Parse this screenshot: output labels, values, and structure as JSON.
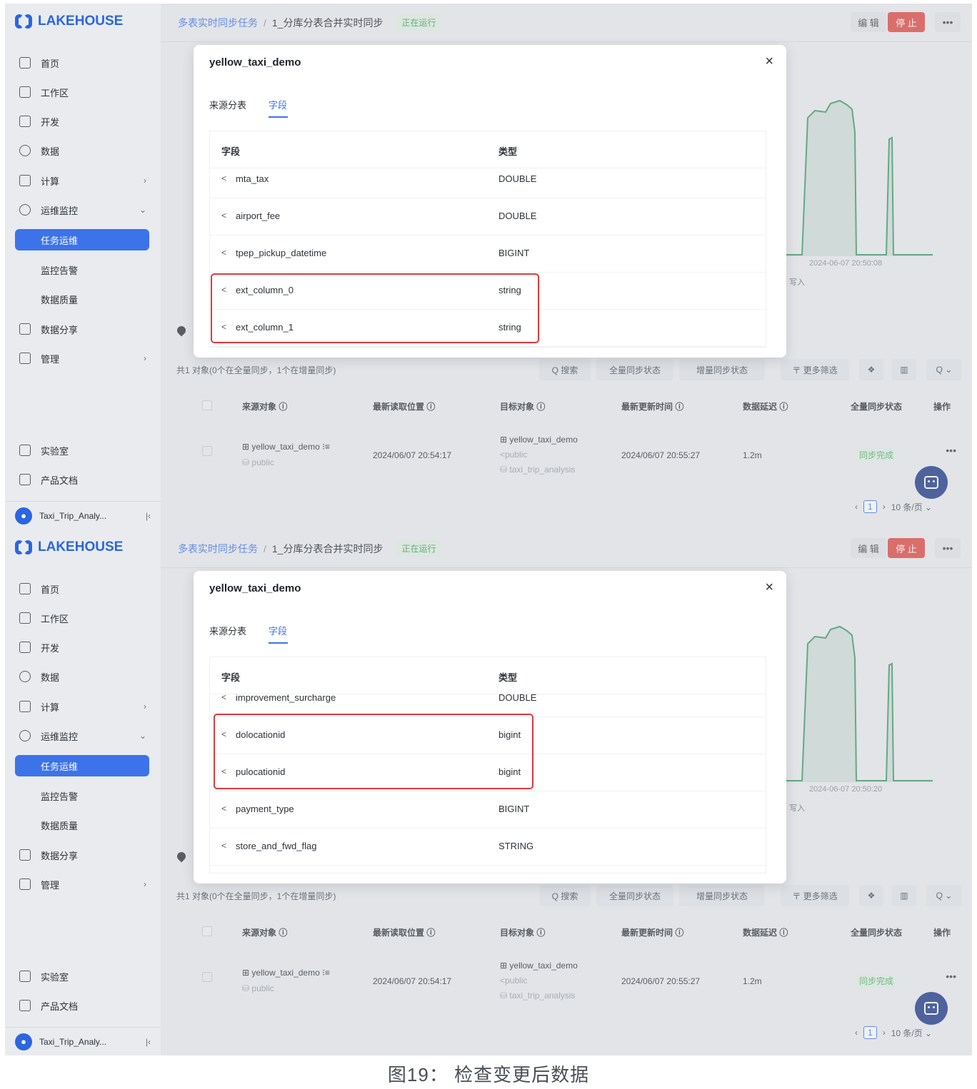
{
  "sidebar": {
    "logo": "LAKEHOUSE",
    "items": [
      "首页",
      "工作区",
      "开发",
      "数据",
      "计算",
      "运维监控"
    ],
    "sub_items": [
      "任务运维",
      "监控告警",
      "数据质量"
    ],
    "items_after": [
      "数据分享",
      "管理"
    ],
    "bottom_items": [
      "实验室",
      "产品文档"
    ],
    "workspace_avatar": "●",
    "workspace": "Taxi_Trip_Analy..."
  },
  "header": {
    "breadcrumb_root": "多表实时同步任务",
    "breadcrumb_sep": "/",
    "breadcrumb_current": "1_分库分表合并实时同步",
    "status": "正在运行",
    "edit": "编 辑",
    "stop": "停 止",
    "more": "•••"
  },
  "charts": [
    {
      "date_label": "2024-06-07 20:50:08",
      "legend": "写入"
    },
    {
      "date_label": "2024-06-07 20:50:20",
      "legend": "写入"
    }
  ],
  "list": {
    "summary": "共1 对象(0个在全量同步，1个在增量同步)",
    "toolbar": [
      "Q 搜索",
      "全量同步状态",
      "增量同步状态",
      "〒 更多筛选",
      "❖",
      "▥",
      "Q ⌄"
    ],
    "columns": [
      "来源对象 ⓘ",
      "最新读取位置 ⓘ",
      "目标对象 ⓘ",
      "最新更新时间 ⓘ",
      "数据延迟 ⓘ",
      "全量同步状态",
      "操作"
    ],
    "row": {
      "source": "⊞ yellow_taxi_demo ⁝≡",
      "source_schema": "⛁ public",
      "read_pos": "2024/06/07 20:54:17",
      "target": "⊞ yellow_taxi_demo",
      "target_schema": "<public",
      "target_db": "⛁ taxi_trip_analysis",
      "update_time": "2024/06/07 20:55:27",
      "latency": "1.2m",
      "full_status": "同步完成",
      "more": "•••"
    },
    "pager": {
      "prev": "‹",
      "page": "1",
      "next": "›",
      "size": "10 条/页 ⌄"
    }
  },
  "modals": [
    {
      "title": "yellow_taxi_demo",
      "close": "×",
      "tab_source": "来源分表",
      "tab_fields": "字段",
      "col_field": "字段",
      "col_type": "类型",
      "rows": [
        {
          "name": "mta_tax",
          "type": "DOUBLE"
        },
        {
          "name": "airport_fee",
          "type": "DOUBLE"
        },
        {
          "name": "tpep_pickup_datetime",
          "type": "BIGINT"
        },
        {
          "name": "ext_column_0",
          "type": "string"
        },
        {
          "name": "ext_column_1",
          "type": "string"
        }
      ]
    },
    {
      "title": "yellow_taxi_demo",
      "close": "×",
      "tab_source": "来源分表",
      "tab_fields": "字段",
      "col_field": "字段",
      "col_type": "类型",
      "rows": [
        {
          "name": "improvement_surcharge",
          "type": "DOUBLE"
        },
        {
          "name": "dolocationid",
          "type": "bigint"
        },
        {
          "name": "pulocationid",
          "type": "bigint"
        },
        {
          "name": "payment_type",
          "type": "BIGINT"
        },
        {
          "name": "store_and_fwd_flag",
          "type": "STRING"
        }
      ]
    }
  ],
  "link_icon": "<",
  "caption": "图19： 检查变更后数据",
  "colors": {
    "primary": "#3d73e8",
    "danger": "#e04a44",
    "success": "#52b06f",
    "highlight": "#e0383c"
  }
}
